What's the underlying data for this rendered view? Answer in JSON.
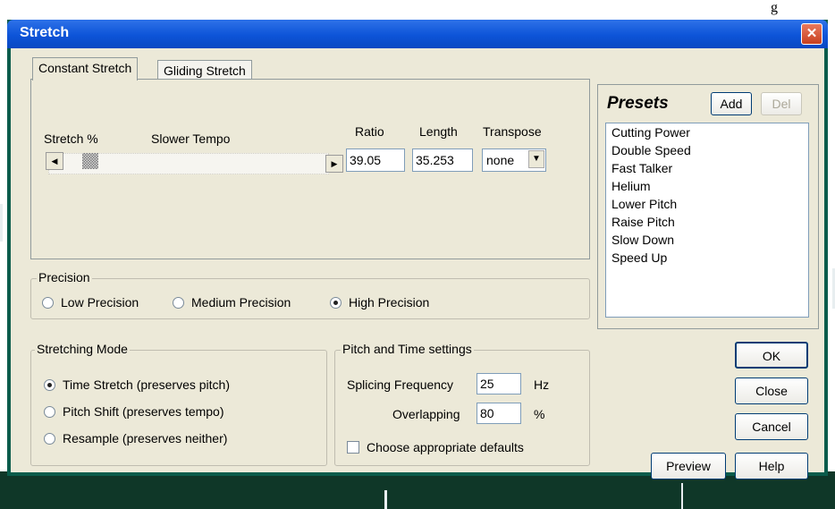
{
  "background": {
    "fragment_text": "g"
  },
  "window": {
    "title": "Stretch",
    "close_icon": "close-icon",
    "accent": "#0a54d8"
  },
  "tabs": [
    {
      "label": "Constant Stretch",
      "active": true
    },
    {
      "label": "Gliding Stretch",
      "active": false
    }
  ],
  "stretch": {
    "stretch_pct_label": "Stretch %",
    "tempo_label": "Slower Tempo",
    "ratio_label": "Ratio",
    "ratio_value": "39.05",
    "length_label": "Length",
    "length_value": "35.253",
    "transpose_label": "Transpose",
    "transpose_value": "none",
    "slider_level": 0.07
  },
  "precision": {
    "title": "Precision",
    "options": [
      {
        "label": "Low Precision",
        "selected": false
      },
      {
        "label": "Medium Precision",
        "selected": false
      },
      {
        "label": "High Precision",
        "selected": true
      }
    ]
  },
  "stretching_mode": {
    "title": "Stretching Mode",
    "options": [
      {
        "label": "Time Stretch (preserves pitch)",
        "selected": true
      },
      {
        "label": "Pitch Shift (preserves tempo)",
        "selected": false
      },
      {
        "label": "Resample (preserves neither)",
        "selected": false
      }
    ]
  },
  "pitch_time": {
    "title": "Pitch and Time settings",
    "splicing_label": "Splicing Frequency",
    "splicing_value": "25",
    "splicing_unit": "Hz",
    "overlapping_label": "Overlapping",
    "overlapping_value": "80",
    "overlapping_unit": "%",
    "defaults_label": "Choose appropriate defaults",
    "defaults_checked": false
  },
  "presets": {
    "title": "Presets",
    "add_label": "Add",
    "del_label": "Del",
    "items": [
      "Cutting Power",
      "Double Speed",
      "Fast Talker",
      "Helium",
      "Lower Pitch",
      "Raise Pitch",
      "Slow Down",
      "Speed Up"
    ]
  },
  "buttons": {
    "ok": "OK",
    "close": "Close",
    "cancel": "Cancel",
    "preview": "Preview",
    "help": "Help"
  }
}
